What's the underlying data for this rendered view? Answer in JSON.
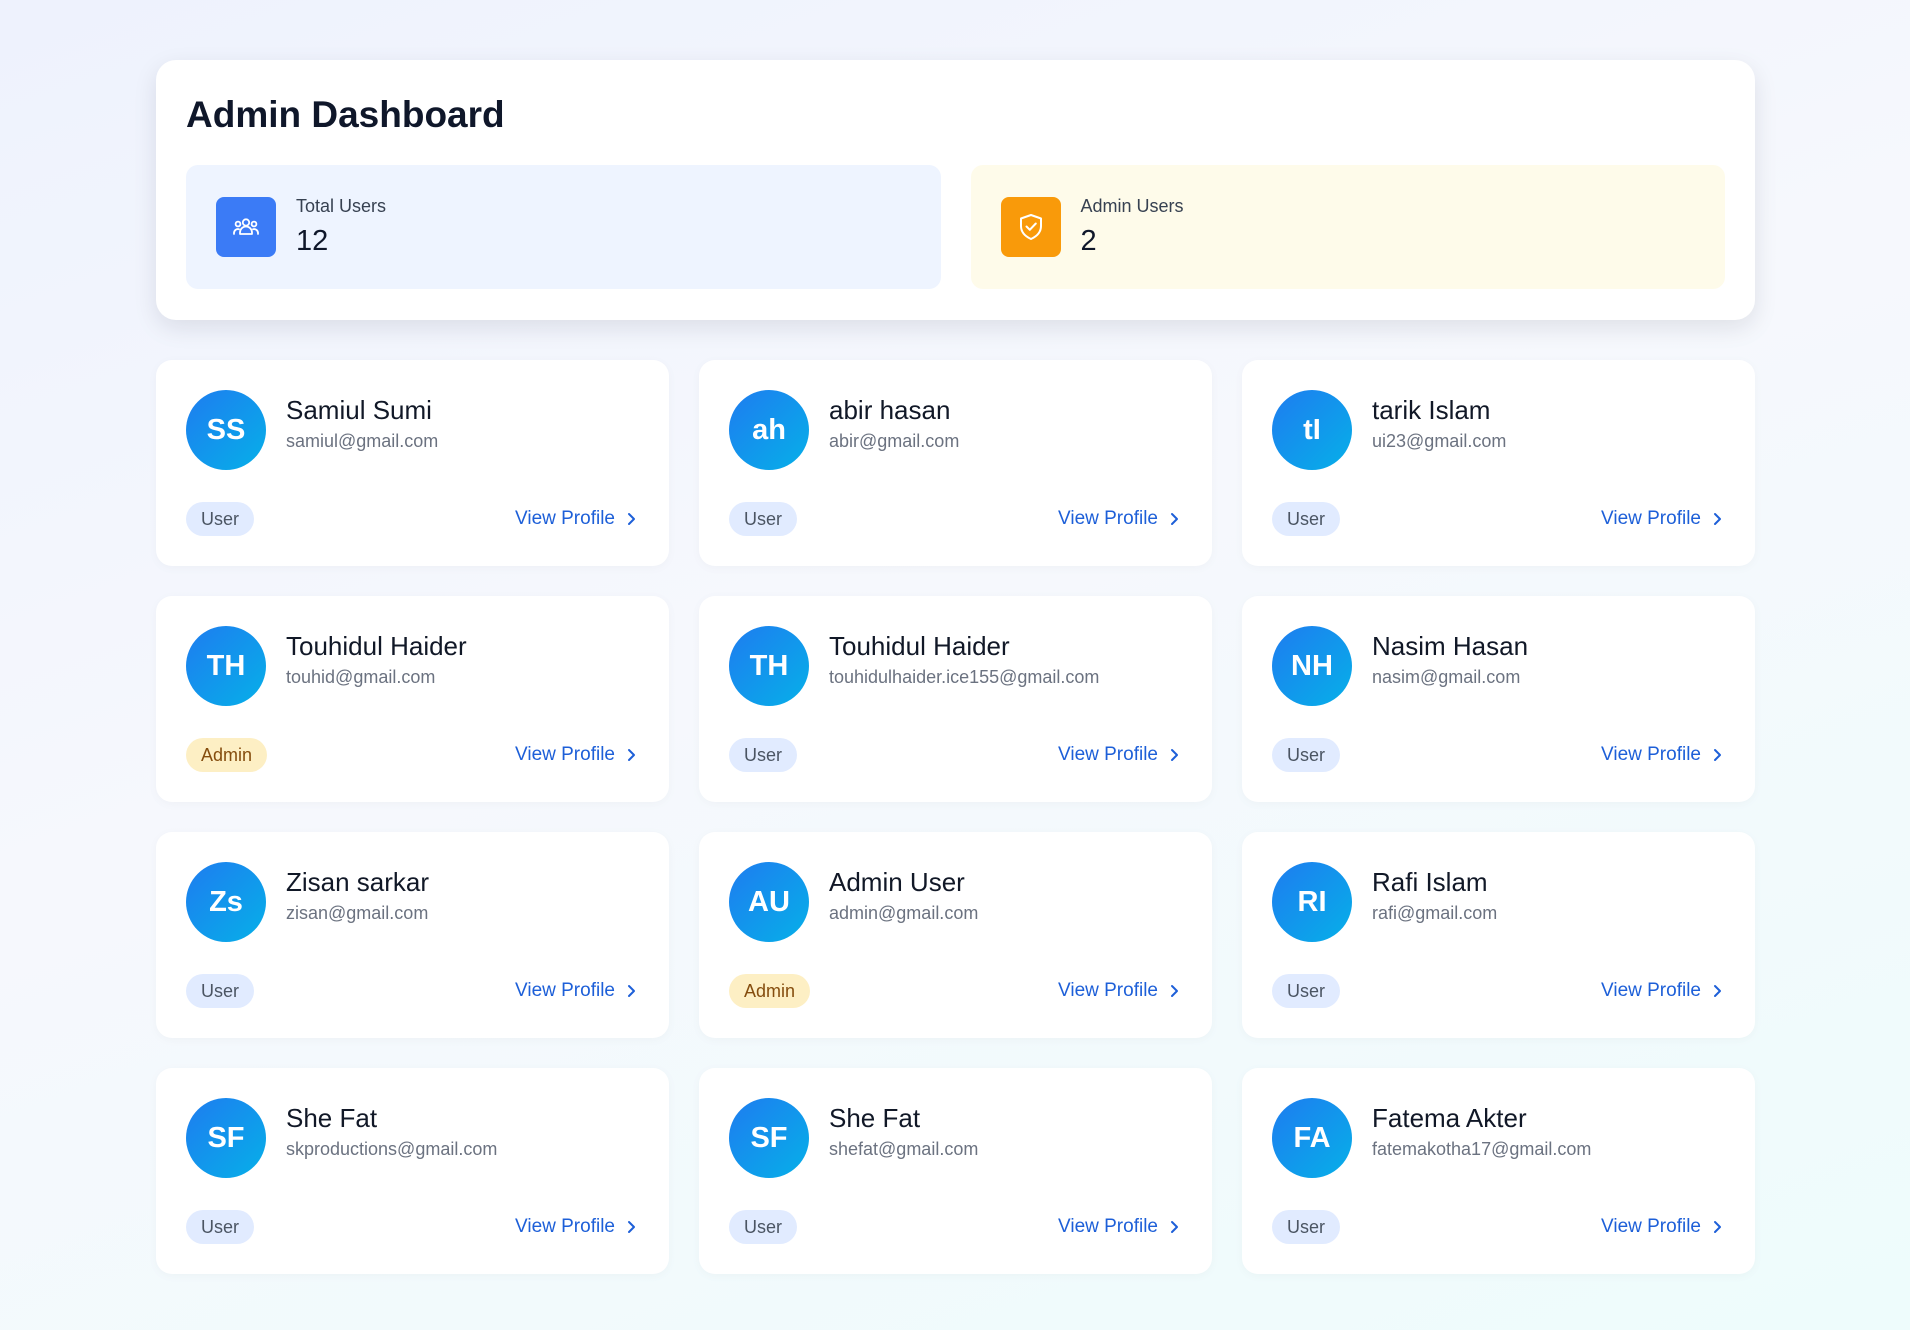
{
  "header": {
    "title": "Admin Dashboard"
  },
  "stats": {
    "total_users": {
      "label": "Total Users",
      "value": "12",
      "icon": "users-group-icon",
      "color": "#3b7bf6"
    },
    "admin_users": {
      "label": "Admin Users",
      "value": "2",
      "icon": "shield-check-icon",
      "color": "#f99a0a"
    }
  },
  "users": [
    {
      "initials": "SS",
      "name": "Samiul Sumi",
      "email": "samiul@gmail.com",
      "role": "User",
      "action": "View Profile"
    },
    {
      "initials": "ah",
      "name": "abir hasan",
      "email": "abir@gmail.com",
      "role": "User",
      "action": "View Profile"
    },
    {
      "initials": "tI",
      "name": "tarik Islam",
      "email": "ui23@gmail.com",
      "role": "User",
      "action": "View Profile"
    },
    {
      "initials": "TH",
      "name": "Touhidul Haider",
      "email": "touhid@gmail.com",
      "role": "Admin",
      "action": "View Profile"
    },
    {
      "initials": "TH",
      "name": "Touhidul Haider",
      "email": "touhidulhaider.ice155@gmail.com",
      "role": "User",
      "action": "View Profile"
    },
    {
      "initials": "NH",
      "name": "Nasim Hasan",
      "email": "nasim@gmail.com",
      "role": "User",
      "action": "View Profile"
    },
    {
      "initials": "Zs",
      "name": "Zisan sarkar",
      "email": "zisan@gmail.com",
      "role": "User",
      "action": "View Profile"
    },
    {
      "initials": "AU",
      "name": "Admin User",
      "email": "admin@gmail.com",
      "role": "Admin",
      "action": "View Profile"
    },
    {
      "initials": "RI",
      "name": "Rafi Islam",
      "email": "rafi@gmail.com",
      "role": "User",
      "action": "View Profile"
    },
    {
      "initials": "SF",
      "name": "She Fat",
      "email": "skproductions@gmail.com",
      "role": "User",
      "action": "View Profile"
    },
    {
      "initials": "SF",
      "name": "She Fat",
      "email": "shefat@gmail.com",
      "role": "User",
      "action": "View Profile"
    },
    {
      "initials": "FA",
      "name": "Fatema Akter",
      "email": "fatemakotha17@gmail.com",
      "role": "User",
      "action": "View Profile"
    }
  ]
}
